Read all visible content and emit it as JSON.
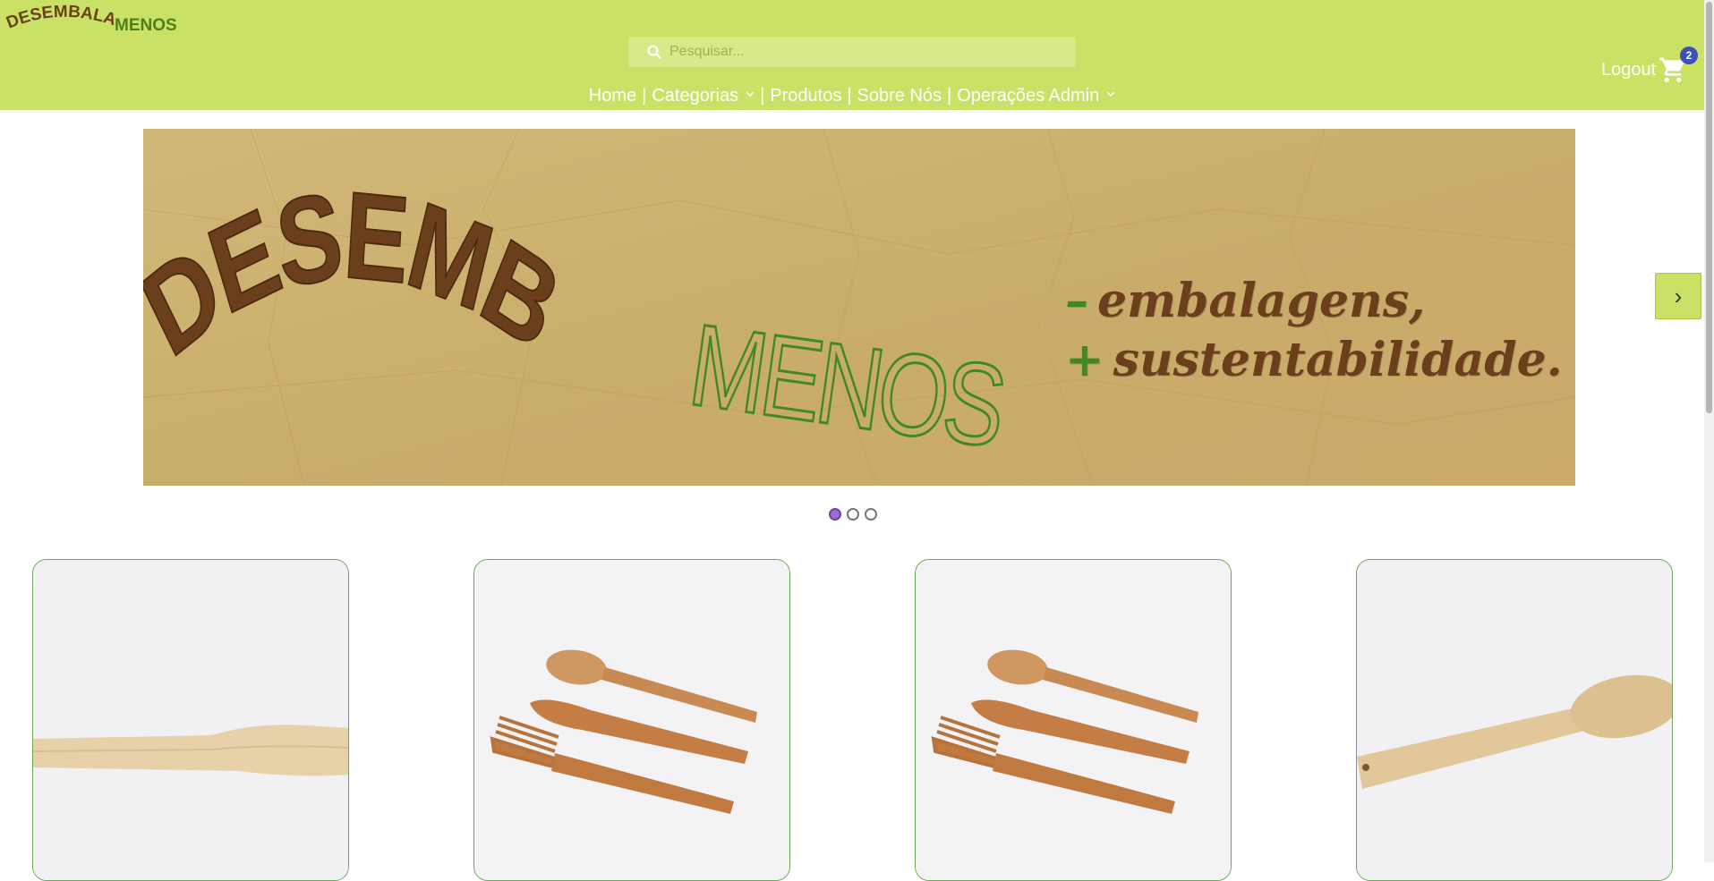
{
  "header": {
    "logo_text_1": "DESEMBALA",
    "logo_text_2": "MENOS",
    "search_placeholder": "Pesquisar...",
    "nav": [
      {
        "label": "Home",
        "has_dropdown": false
      },
      {
        "label": "Categorias",
        "has_dropdown": true
      },
      {
        "label": "Produtos",
        "has_dropdown": false
      },
      {
        "label": "Sobre Nós",
        "has_dropdown": false
      },
      {
        "label": "Operações Admin",
        "has_dropdown": true
      }
    ],
    "separator": "|",
    "logout_label": "Logout",
    "cart_count": "2"
  },
  "banner": {
    "brand_1": "DESEMBALA",
    "brand_2": "MENOS",
    "tag_line_1_symbol": "–",
    "tag_line_1": "embalagens,",
    "tag_line_2_symbol": "+",
    "tag_line_2": "sustentabilidade.",
    "next_arrow": "›",
    "slide_count": 3,
    "active_slide": 1
  },
  "products": [
    {
      "image": "wooden-spatula"
    },
    {
      "image": "bamboo-cutlery-set"
    },
    {
      "image": "bamboo-cutlery-set"
    },
    {
      "image": "wooden-spoon"
    }
  ],
  "colors": {
    "header_bg": "#c9e265",
    "brown": "#6b3f1c",
    "green": "#3f8a1f",
    "card_border": "#6aaa55",
    "badge": "#3f51b5"
  }
}
